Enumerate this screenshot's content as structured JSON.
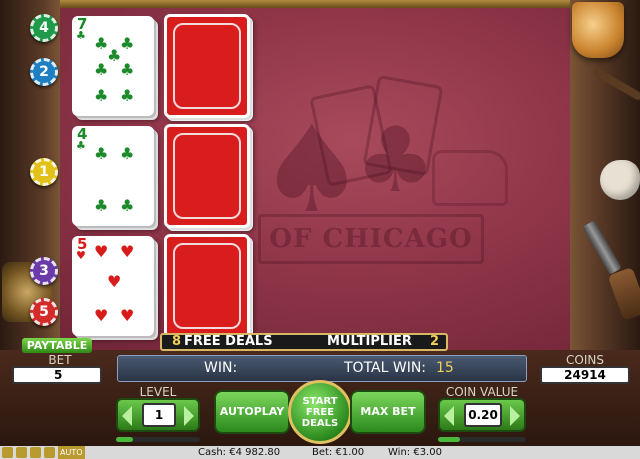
{
  "game": {
    "watermark_text": "OF CHICAGO",
    "colors": {
      "felt": "#8f3548",
      "card_back": "#d91d1d",
      "club": "#1a8a2a",
      "heart": "#d81c1c",
      "accent": "#f2d05a",
      "button_green": "#4ab83a"
    }
  },
  "chips": [
    {
      "label": "4",
      "color": "#1f9a4a"
    },
    {
      "label": "2",
      "color": "#1e7fc2"
    },
    {
      "label": "1",
      "color": "#e2c21a"
    },
    {
      "label": "3",
      "color": "#6a3aa8"
    },
    {
      "label": "5",
      "color": "#d32a2a"
    }
  ],
  "hands": [
    {
      "rank": "7",
      "suit": "♣",
      "suit_name": "club"
    },
    {
      "rank": "4",
      "suit": "♣",
      "suit_name": "club"
    },
    {
      "rank": "5",
      "suit": "♥",
      "suit_name": "heart"
    }
  ],
  "info": {
    "free_deals_count": "8",
    "free_deals_label": "FREE DEALS",
    "multiplier_label": "MULTIPLIER",
    "multiplier_value": "2"
  },
  "win_bar": {
    "win_label": "WIN:",
    "total_win_label": "TOTAL WIN:",
    "total_win_value": "15"
  },
  "controls": {
    "paytable_label": "PAYTABLE",
    "bet_label": "BET",
    "bet_value": "5",
    "coins_label": "COINS",
    "coins_value": "24914",
    "level_label": "LEVEL",
    "level_value": "1",
    "autoplay_label": "AUTOPLAY",
    "start_label": "START FREE DEALS",
    "max_bet_label": "MAX BET",
    "coin_value_label": "COIN VALUE",
    "coin_value": "0.20",
    "level_progress": 0.2,
    "coin_progress": 0.25
  },
  "status_bar": {
    "cash": "Cash: €4 982.80",
    "bet": "Bet: €1.00",
    "win": "Win: €3.00",
    "auto_label": "AUTO"
  }
}
